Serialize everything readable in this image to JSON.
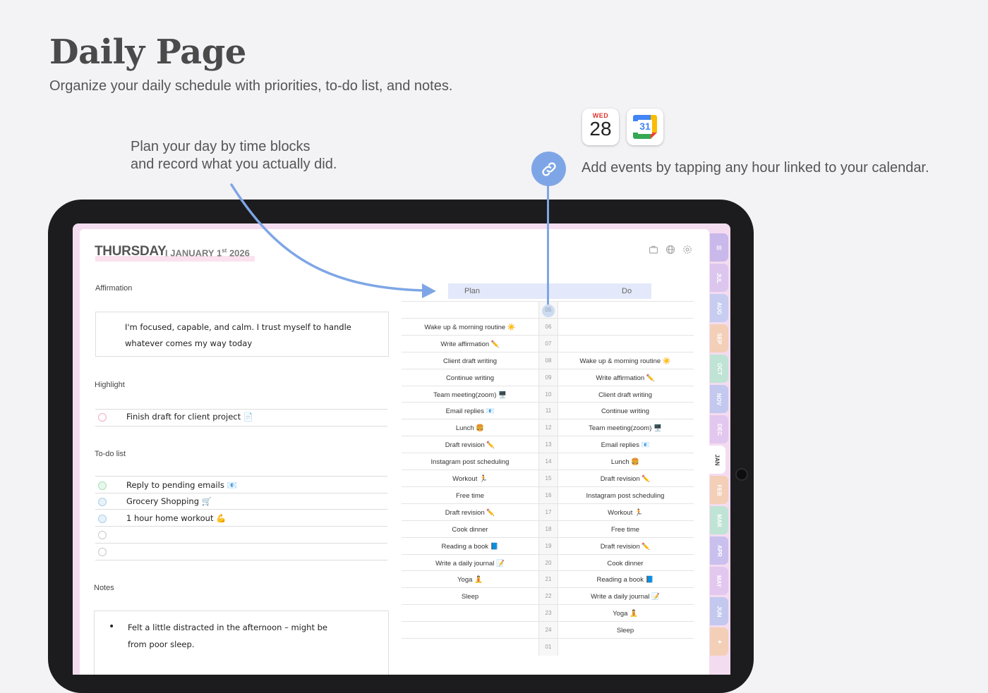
{
  "hero": {
    "title": "Daily Page",
    "subtitle": "Organize your daily schedule with priorities, to-do list, and notes."
  },
  "callouts": {
    "left_line1": "Plan your day by time blocks",
    "left_line2": "and record what you actually did.",
    "right": "Add events by tapping any hour linked to your calendar."
  },
  "app_icons": {
    "apple_calendar": {
      "day_of_week": "WED",
      "day_number": "28"
    },
    "google_calendar": {
      "day_number": "31"
    }
  },
  "colors": {
    "accent_blue": "#7ea6e6",
    "tab_colors": [
      "#c9b8ea",
      "#dcc6ee",
      "#c7cdf0",
      "#f3cfb8",
      "#bfe3d5",
      "#c3c8ef",
      "#e2c7ef",
      "#ffffff",
      "#f3cfb8",
      "#bfe3d5",
      "#c9c0ee",
      "#e2c7ef",
      "#c3c8ef",
      "#f3cfb8"
    ]
  },
  "planner": {
    "day": "THURSDAY",
    "date_prefix": "I  JANUARY 1",
    "date_suffix": "st",
    "date_year": " 2026",
    "header_icons": [
      "briefcase-icon",
      "globe-icon",
      "settings-icon"
    ],
    "affirmation": {
      "label": "Affirmation",
      "line1": "I'm focused, capable, and calm. I trust myself to handle",
      "line2": "whatever comes my way today"
    },
    "highlight": {
      "label": "Highlight",
      "text": "Finish draft for client project 📄"
    },
    "todo": {
      "label": "To-do list",
      "items": [
        {
          "text": "Reply to pending emails 📧",
          "done": true
        },
        {
          "text": "Grocery Shopping 🛒",
          "done": true
        },
        {
          "text": "1 hour home workout 💪",
          "done": true
        },
        {
          "text": "",
          "done": false
        },
        {
          "text": "",
          "done": false
        }
      ]
    },
    "notes": {
      "label": "Notes",
      "bullet": "•",
      "line1": "Felt a little distracted in the afternoon – might be",
      "line2": "from poor sleep."
    },
    "schedule_header": {
      "plan": "Plan",
      "do": "Do"
    },
    "schedule": [
      {
        "hour": "05",
        "plan": "",
        "do": ""
      },
      {
        "hour": "06",
        "plan": "Wake up & morning routine ☀️",
        "do": ""
      },
      {
        "hour": "07",
        "plan": "Write affirmation ✏️",
        "do": ""
      },
      {
        "hour": "08",
        "plan": "Client draft writing",
        "do": "Wake up & morning routine ☀️"
      },
      {
        "hour": "09",
        "plan": "Continue writing",
        "do": "Write affirmation ✏️"
      },
      {
        "hour": "10",
        "plan": "Team meeting(zoom) 🖥️",
        "do": "Client draft writing"
      },
      {
        "hour": "11",
        "plan": "Email replies 📧",
        "do": "Continue writing"
      },
      {
        "hour": "12",
        "plan": "Lunch 🍔",
        "do": "Team meeting(zoom) 🖥️"
      },
      {
        "hour": "13",
        "plan": "Draft revision ✏️",
        "do": "Email replies 📧"
      },
      {
        "hour": "14",
        "plan": "Instagram post scheduling",
        "do": "Lunch 🍔"
      },
      {
        "hour": "15",
        "plan": "Workout 🏃",
        "do": "Draft revision ✏️"
      },
      {
        "hour": "16",
        "plan": "Free time",
        "do": "Instagram post scheduling"
      },
      {
        "hour": "17",
        "plan": "Draft revision ✏️",
        "do": "Workout 🏃"
      },
      {
        "hour": "18",
        "plan": "Cook dinner",
        "do": "Free time"
      },
      {
        "hour": "19",
        "plan": "Reading a book 📘",
        "do": "Draft revision ✏️"
      },
      {
        "hour": "20",
        "plan": "Write a daily journal 📝",
        "do": "Cook dinner"
      },
      {
        "hour": "21",
        "plan": "Yoga 🧘",
        "do": "Reading a book 📘"
      },
      {
        "hour": "22",
        "plan": "Sleep",
        "do": "Write a daily journal 📝"
      },
      {
        "hour": "23",
        "plan": "",
        "do": "Yoga 🧘"
      },
      {
        "hour": "24",
        "plan": "",
        "do": "Sleep"
      },
      {
        "hour": "01",
        "plan": "",
        "do": ""
      }
    ],
    "month_tabs": [
      "☰",
      "JUL",
      "AUG",
      "SEP",
      "OCT",
      "NOV",
      "DEC",
      "JAN",
      "FEB",
      "MAR",
      "APR",
      "MAY",
      "JUN",
      "✦"
    ]
  }
}
